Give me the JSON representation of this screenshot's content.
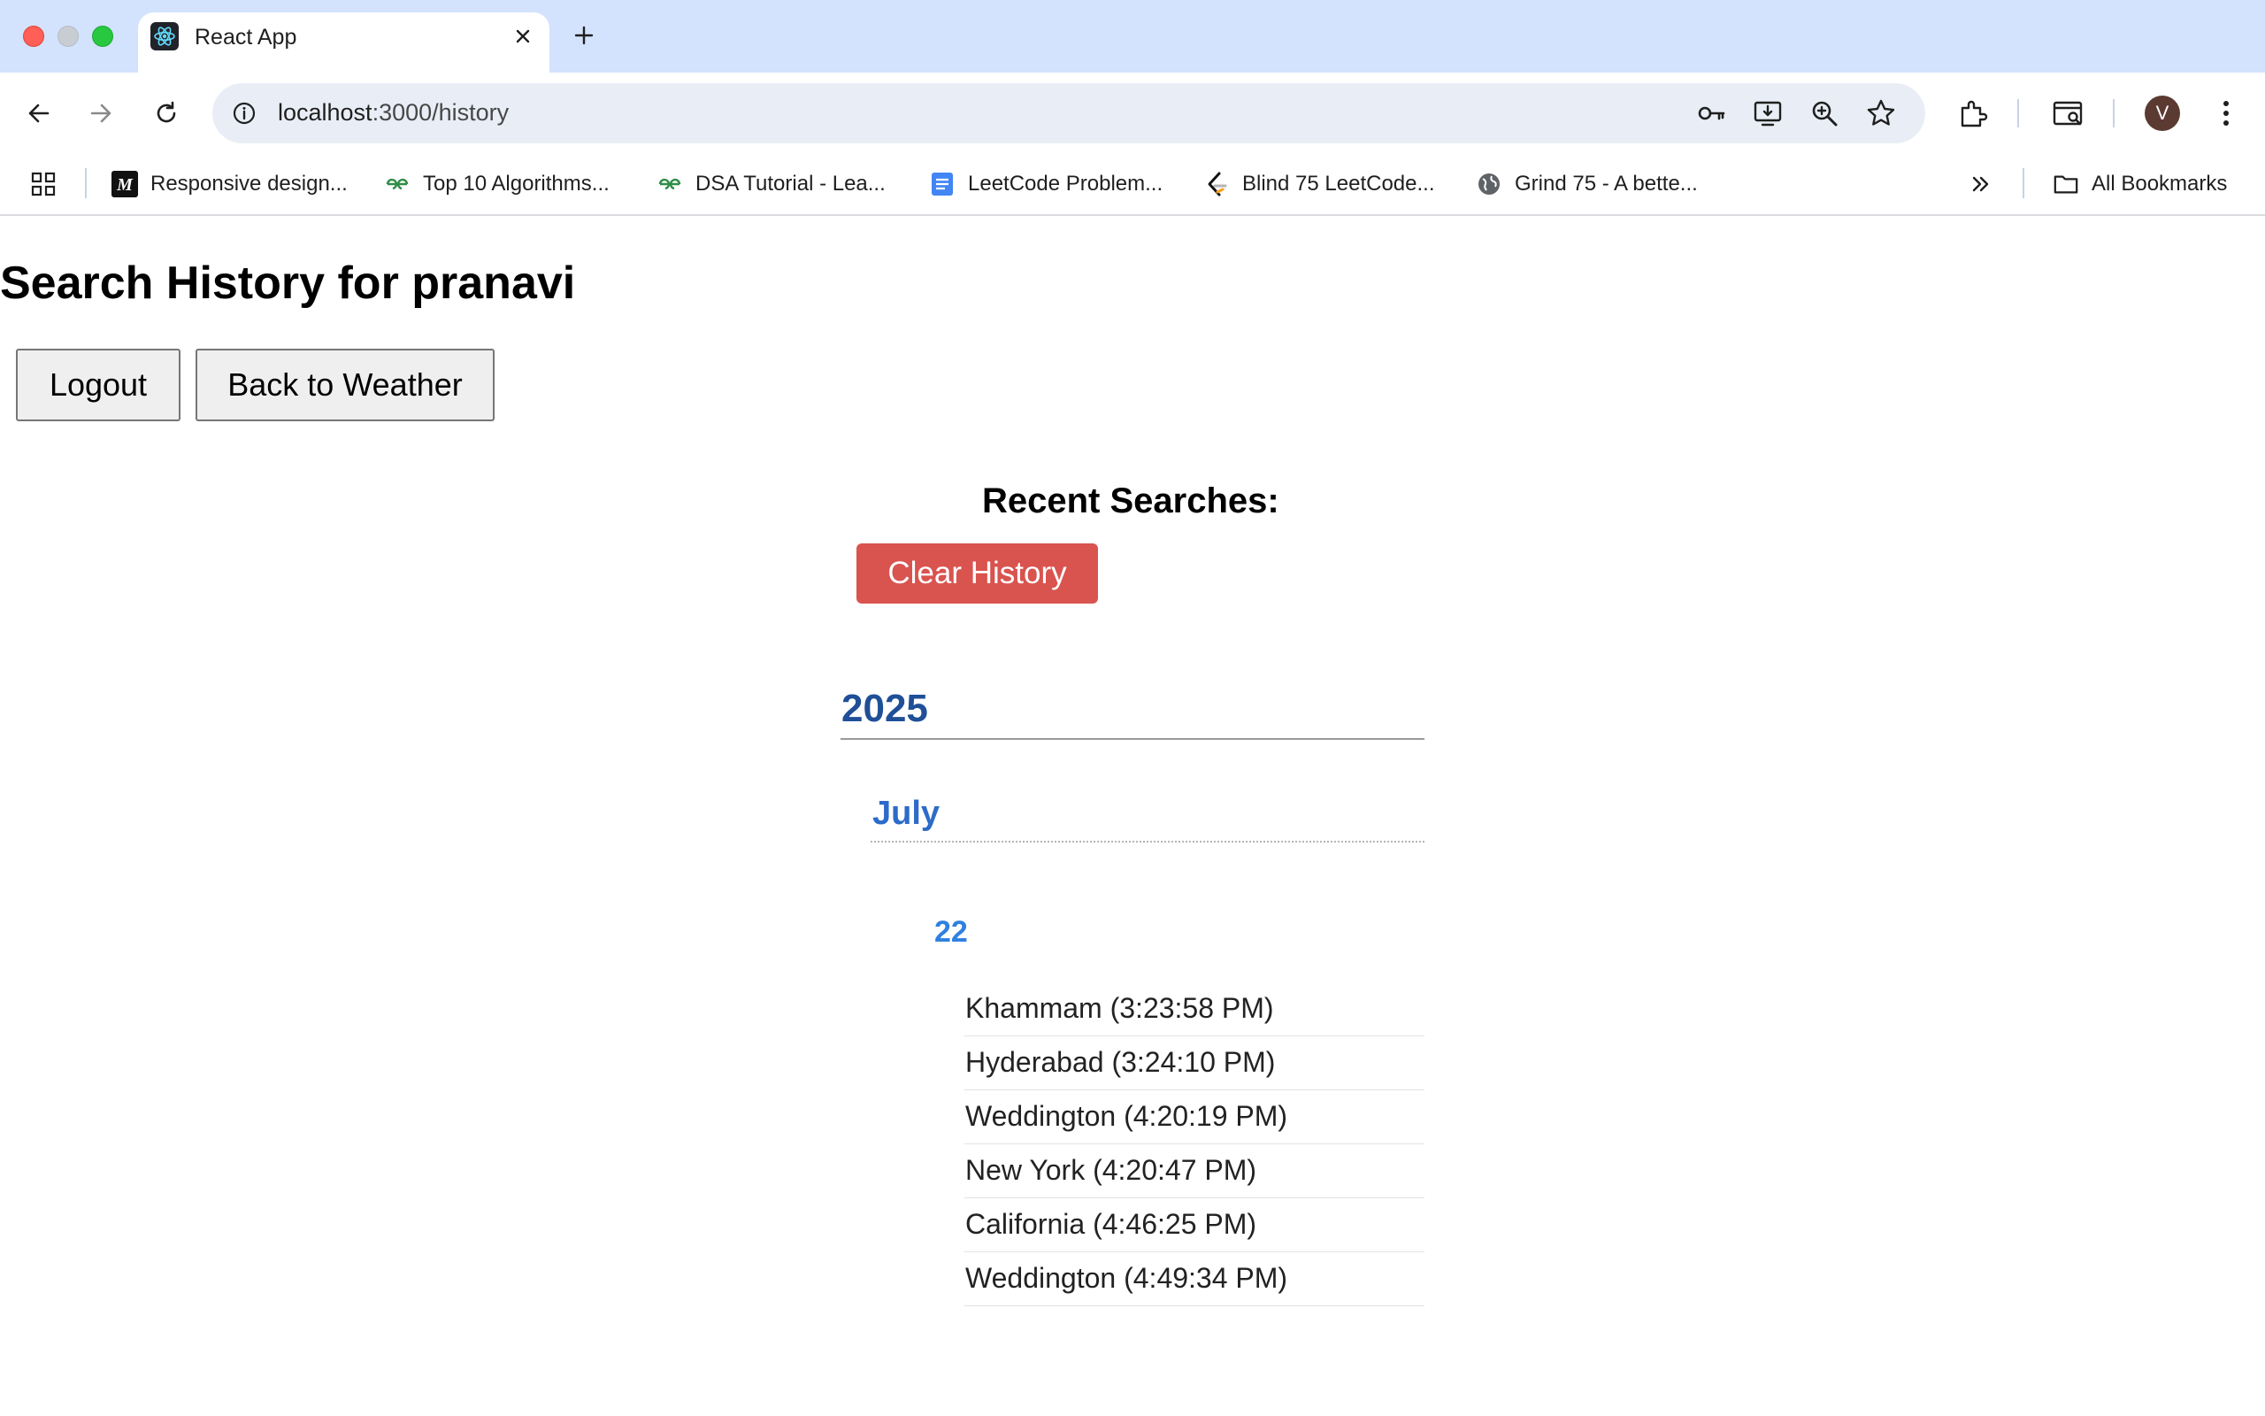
{
  "browser": {
    "tab_title": "React App",
    "url_host": "localhost",
    "url_path": ":3000/history",
    "avatar_letter": "V",
    "bookmarks": [
      {
        "label": "Responsive design...",
        "icon": "medium-icon"
      },
      {
        "label": "Top 10 Algorithms...",
        "icon": "gfg-icon"
      },
      {
        "label": "DSA Tutorial - Lea...",
        "icon": "gfg-icon"
      },
      {
        "label": "LeetCode Problem...",
        "icon": "docs-icon"
      },
      {
        "label": "Blind 75 LeetCode...",
        "icon": "leetcode-icon"
      },
      {
        "label": "Grind 75 - A bette...",
        "icon": "globe-icon"
      }
    ],
    "all_bookmarks_label": "All Bookmarks"
  },
  "page": {
    "title": "Search History for pranavi",
    "logout_label": "Logout",
    "back_label": "Back to Weather",
    "recent_title": "Recent Searches:",
    "clear_label": "Clear History",
    "year": "2025",
    "month": "July",
    "day": "22",
    "entries": [
      "Khammam (3:23:58 PM)",
      "Hyderabad (3:24:10 PM)",
      "Weddington (4:20:19 PM)",
      "New York (4:20:47 PM)",
      "California (4:46:25 PM)",
      "Weddington (4:49:34 PM)"
    ]
  },
  "colors": {
    "clear_button": "#d9534f",
    "year_text": "#1f4f97",
    "month_text": "#2c6bc9",
    "day_text": "#2f80e0",
    "tabbar": "#d3e3fd"
  }
}
